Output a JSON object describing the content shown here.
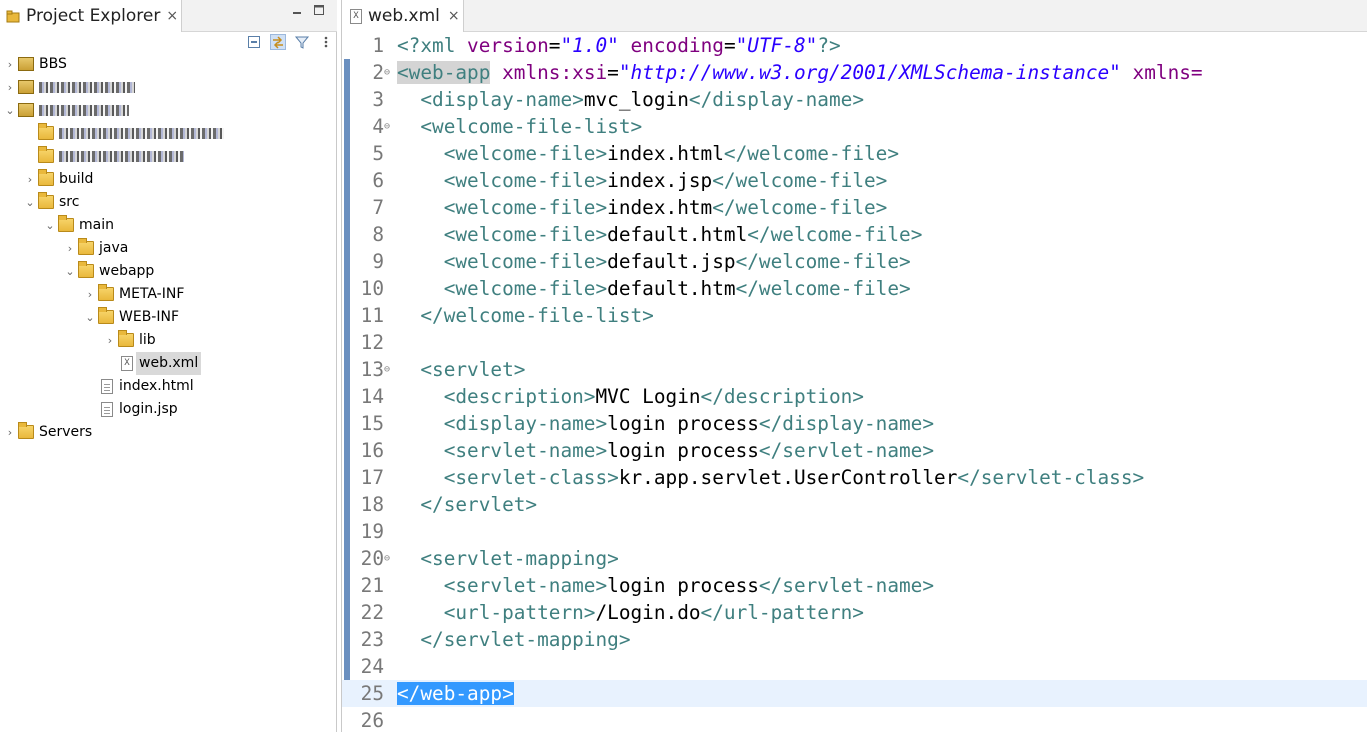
{
  "explorer": {
    "title": "Project Explorer",
    "close": "×",
    "tree": [
      {
        "label": "BBS",
        "icon": "project-icon",
        "chev": "›",
        "indent": 0
      },
      {
        "label": "",
        "icon": "project-icon",
        "chev": "›",
        "indent": 0,
        "redacted": true
      },
      {
        "label": "",
        "icon": "project-icon",
        "chev": "⌄",
        "indent": 0,
        "redacted": true
      },
      {
        "label": "",
        "icon": "folder-icon",
        "chev": "",
        "indent": 1,
        "redacted": true
      },
      {
        "label": "",
        "icon": "folder-icon",
        "chev": "",
        "indent": 1,
        "redacted": true
      },
      {
        "label": "build",
        "icon": "folder-icon",
        "chev": "›",
        "indent": 1
      },
      {
        "label": "src",
        "icon": "folder-icon",
        "chev": "⌄",
        "indent": 1
      },
      {
        "label": "main",
        "icon": "folder-icon",
        "chev": "⌄",
        "indent": 2
      },
      {
        "label": "java",
        "icon": "folder-icon",
        "chev": "›",
        "indent": 3
      },
      {
        "label": "webapp",
        "icon": "folder-icon",
        "chev": "⌄",
        "indent": 3
      },
      {
        "label": "META-INF",
        "icon": "folder-icon",
        "chev": "›",
        "indent": 4
      },
      {
        "label": "WEB-INF",
        "icon": "folder-icon",
        "chev": "⌄",
        "indent": 4
      },
      {
        "label": "lib",
        "icon": "folder-icon",
        "chev": "›",
        "indent": 5
      },
      {
        "label": "web.xml",
        "icon": "xml-file-icon",
        "chev": "",
        "indent": 5,
        "selected": true
      },
      {
        "label": "index.html",
        "icon": "file-icon",
        "chev": "",
        "indent": 4
      },
      {
        "label": "login.jsp",
        "icon": "file-icon",
        "chev": "",
        "indent": 4
      },
      {
        "label": "Servers",
        "icon": "folder-icon",
        "chev": "›",
        "indent": 0
      }
    ]
  },
  "editor": {
    "tab_title": "web.xml",
    "close": "×",
    "current_line": 25,
    "lines": [
      {
        "n": "1",
        "fold": "",
        "segs": [
          [
            "pi",
            "<?xml "
          ],
          [
            "attr",
            "version"
          ],
          [
            "txt",
            "="
          ],
          [
            "val",
            "\"1.0\""
          ],
          [
            "txt",
            " "
          ],
          [
            "attr",
            "encoding"
          ],
          [
            "txt",
            "="
          ],
          [
            "val",
            "\"UTF-8\""
          ],
          [
            "pi",
            "?>"
          ]
        ]
      },
      {
        "n": "2",
        "fold": "⊖",
        "segs": [
          [
            "tagm",
            "<web-app"
          ],
          [
            "txt",
            " "
          ],
          [
            "attr",
            "xmlns:xsi"
          ],
          [
            "txt",
            "="
          ],
          [
            "val",
            "\"http://www.w3.org/2001/XMLSchema-instance\""
          ],
          [
            "txt",
            " "
          ],
          [
            "attr",
            "xmlns="
          ]
        ]
      },
      {
        "n": "3",
        "fold": "",
        "segs": [
          [
            "txt",
            "  "
          ],
          [
            "tag",
            "<display-name>"
          ],
          [
            "txt",
            "mvc_login"
          ],
          [
            "tag",
            "</display-name>"
          ]
        ]
      },
      {
        "n": "4",
        "fold": "⊖",
        "segs": [
          [
            "txt",
            "  "
          ],
          [
            "tag",
            "<welcome-file-list>"
          ]
        ]
      },
      {
        "n": "5",
        "fold": "",
        "segs": [
          [
            "txt",
            "    "
          ],
          [
            "tag",
            "<welcome-file>"
          ],
          [
            "txt",
            "index.html"
          ],
          [
            "tag",
            "</welcome-file>"
          ]
        ]
      },
      {
        "n": "6",
        "fold": "",
        "segs": [
          [
            "txt",
            "    "
          ],
          [
            "tag",
            "<welcome-file>"
          ],
          [
            "txt",
            "index.jsp"
          ],
          [
            "tag",
            "</welcome-file>"
          ]
        ]
      },
      {
        "n": "7",
        "fold": "",
        "segs": [
          [
            "txt",
            "    "
          ],
          [
            "tag",
            "<welcome-file>"
          ],
          [
            "txt",
            "index.htm"
          ],
          [
            "tag",
            "</welcome-file>"
          ]
        ]
      },
      {
        "n": "8",
        "fold": "",
        "segs": [
          [
            "txt",
            "    "
          ],
          [
            "tag",
            "<welcome-file>"
          ],
          [
            "txt",
            "default.html"
          ],
          [
            "tag",
            "</welcome-file>"
          ]
        ]
      },
      {
        "n": "9",
        "fold": "",
        "segs": [
          [
            "txt",
            "    "
          ],
          [
            "tag",
            "<welcome-file>"
          ],
          [
            "txt",
            "default.jsp"
          ],
          [
            "tag",
            "</welcome-file>"
          ]
        ]
      },
      {
        "n": "10",
        "fold": "",
        "segs": [
          [
            "txt",
            "    "
          ],
          [
            "tag",
            "<welcome-file>"
          ],
          [
            "txt",
            "default.htm"
          ],
          [
            "tag",
            "</welcome-file>"
          ]
        ]
      },
      {
        "n": "11",
        "fold": "",
        "segs": [
          [
            "txt",
            "  "
          ],
          [
            "tag",
            "</welcome-file-list>"
          ]
        ]
      },
      {
        "n": "12",
        "fold": "",
        "segs": []
      },
      {
        "n": "13",
        "fold": "⊖",
        "segs": [
          [
            "txt",
            "  "
          ],
          [
            "tag",
            "<servlet>"
          ]
        ]
      },
      {
        "n": "14",
        "fold": "",
        "segs": [
          [
            "txt",
            "    "
          ],
          [
            "tag",
            "<description>"
          ],
          [
            "txt",
            "MVC Login"
          ],
          [
            "tag",
            "</description>"
          ]
        ]
      },
      {
        "n": "15",
        "fold": "",
        "segs": [
          [
            "txt",
            "    "
          ],
          [
            "tag",
            "<display-name>"
          ],
          [
            "txt",
            "login process"
          ],
          [
            "tag",
            "</display-name>"
          ]
        ]
      },
      {
        "n": "16",
        "fold": "",
        "segs": [
          [
            "txt",
            "    "
          ],
          [
            "tag",
            "<servlet-name>"
          ],
          [
            "txt",
            "login process"
          ],
          [
            "tag",
            "</servlet-name>"
          ]
        ]
      },
      {
        "n": "17",
        "fold": "",
        "segs": [
          [
            "txt",
            "    "
          ],
          [
            "tag",
            "<servlet-class>"
          ],
          [
            "txt",
            "kr.app.servlet.UserController"
          ],
          [
            "tag",
            "</servlet-class>"
          ]
        ]
      },
      {
        "n": "18",
        "fold": "",
        "segs": [
          [
            "txt",
            "  "
          ],
          [
            "tag",
            "</servlet>"
          ]
        ]
      },
      {
        "n": "19",
        "fold": "",
        "segs": []
      },
      {
        "n": "20",
        "fold": "⊖",
        "segs": [
          [
            "txt",
            "  "
          ],
          [
            "tag",
            "<servlet-mapping>"
          ]
        ]
      },
      {
        "n": "21",
        "fold": "",
        "segs": [
          [
            "txt",
            "    "
          ],
          [
            "tag",
            "<servlet-name>"
          ],
          [
            "txt",
            "login process"
          ],
          [
            "tag",
            "</servlet-name>"
          ]
        ]
      },
      {
        "n": "22",
        "fold": "",
        "segs": [
          [
            "txt",
            "    "
          ],
          [
            "tag",
            "<url-pattern>"
          ],
          [
            "txt",
            "/Login.do"
          ],
          [
            "tag",
            "</url-pattern>"
          ]
        ]
      },
      {
        "n": "23",
        "fold": "",
        "segs": [
          [
            "txt",
            "  "
          ],
          [
            "tag",
            "</servlet-mapping>"
          ]
        ]
      },
      {
        "n": "24",
        "fold": "",
        "segs": []
      },
      {
        "n": "25",
        "fold": "",
        "segs": [
          [
            "sel",
            "</web-app>"
          ]
        ]
      },
      {
        "n": "26",
        "fold": "",
        "segs": []
      }
    ]
  }
}
